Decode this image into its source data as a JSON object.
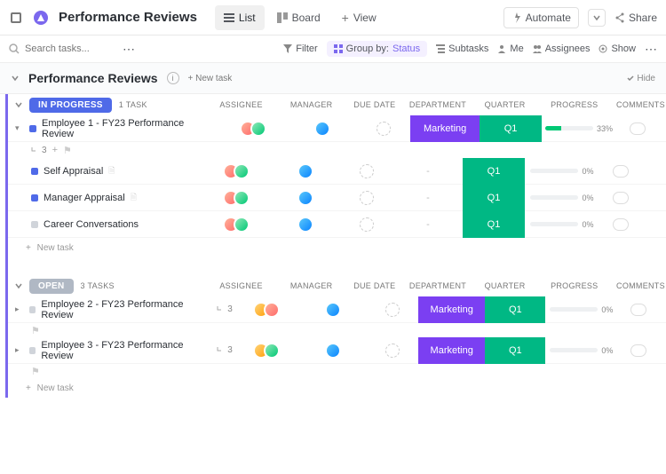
{
  "header": {
    "title": "Performance Reviews",
    "tabs": {
      "list": "List",
      "board": "Board",
      "view": "View"
    },
    "automate": "Automate",
    "share": "Share"
  },
  "toolbar": {
    "search_placeholder": "Search tasks...",
    "filter": "Filter",
    "group_by_label": "Group by:",
    "group_by_value": "Status",
    "subtasks": "Subtasks",
    "me": "Me",
    "assignees": "Assignees",
    "show": "Show"
  },
  "section": {
    "title": "Performance Reviews",
    "new_task_label": "+ New task",
    "hide": "Hide"
  },
  "columns": {
    "assignee": "Assignee",
    "manager": "Manager",
    "due": "Due date",
    "department": "Department",
    "quarter": "Quarter",
    "progress": "Progress",
    "comments": "Comments"
  },
  "group_inprogress": {
    "status": "IN PROGRESS",
    "count": "1 task"
  },
  "task1": {
    "name": "Employee 1 - FY23 Performance Review",
    "sub_count": "3",
    "dept": "Marketing",
    "qtr": "Q1",
    "prog": "33%",
    "prog_w": "33%"
  },
  "task1a": {
    "name": "Self Appraisal",
    "dept": "-",
    "qtr": "Q1",
    "prog": "0%"
  },
  "task1b": {
    "name": "Manager Appraisal",
    "dept": "-",
    "qtr": "Q1",
    "prog": "0%"
  },
  "task1c": {
    "name": "Career Conversations",
    "dept": "-",
    "qtr": "Q1",
    "prog": "0%"
  },
  "new_task_text": "New task",
  "group_open": {
    "status": "OPEN",
    "count": "3 tasks"
  },
  "task2": {
    "name": "Employee 2 - FY23 Performance Review",
    "sub_count": "3",
    "dept": "Marketing",
    "qtr": "Q1",
    "prog": "0%"
  },
  "task3": {
    "name": "Employee 3 - FY23 Performance Review",
    "sub_count": "3",
    "dept": "Marketing",
    "qtr": "Q1",
    "prog": "0%"
  }
}
